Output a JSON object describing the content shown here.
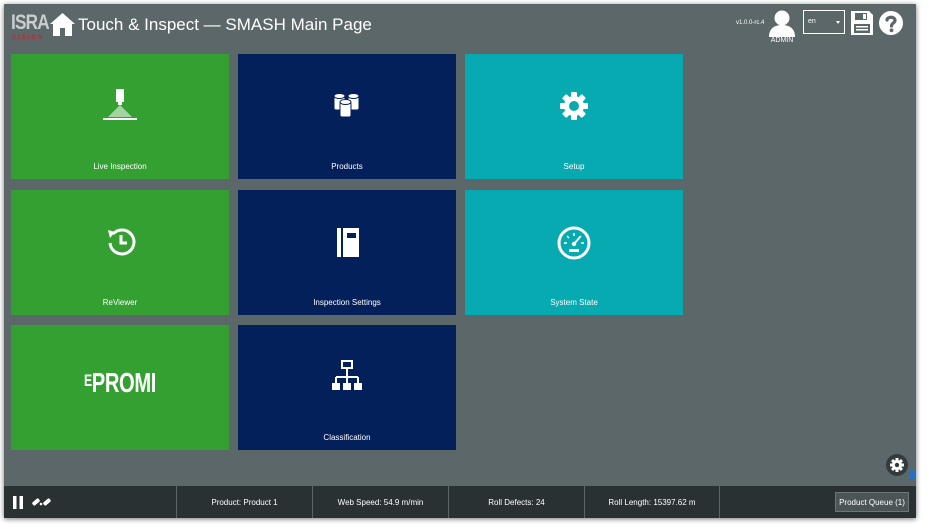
{
  "header": {
    "logo_text": "ISRA",
    "logo_subtext": "VISION",
    "title": "Touch & Inspect — SMASH Main Page",
    "version": "v1.0.0-rc.4",
    "user": "ADMIN",
    "language": "en"
  },
  "tiles": [
    {
      "label": "Live Inspection",
      "icon": "inspection-camera-icon",
      "color": "#34a031"
    },
    {
      "label": "Products",
      "icon": "product-rolls-icon",
      "color": "#03205b"
    },
    {
      "label": "Setup",
      "icon": "gear-icon",
      "color": "#07aab0"
    },
    {
      "label": "ReViewer",
      "icon": "history-icon",
      "color": "#34a031"
    },
    {
      "label": "Inspection Settings",
      "icon": "book-icon",
      "color": "#03205b"
    },
    {
      "label": "System State",
      "icon": "speedometer-icon",
      "color": "#07aab0"
    },
    {
      "label": "EPROMI",
      "logo_sup": "E",
      "logo_main": "PROMI",
      "color": "#34a031"
    },
    {
      "label": "Classification",
      "icon": "hierarchy-icon",
      "color": "#03205b"
    }
  ],
  "status": {
    "product": "Product: Product 1",
    "web_speed": "Web Speed: 54.9 m/min",
    "roll_defects": "Roll Defects: 24",
    "roll_length": "Roll Length: 15397.62 m",
    "queue_button": "Product Queue (1)"
  },
  "colors": {
    "background": "#5c6769",
    "green": "#34a031",
    "navy": "#03205b",
    "teal": "#07aab0",
    "statusbar": "#2a3133"
  }
}
